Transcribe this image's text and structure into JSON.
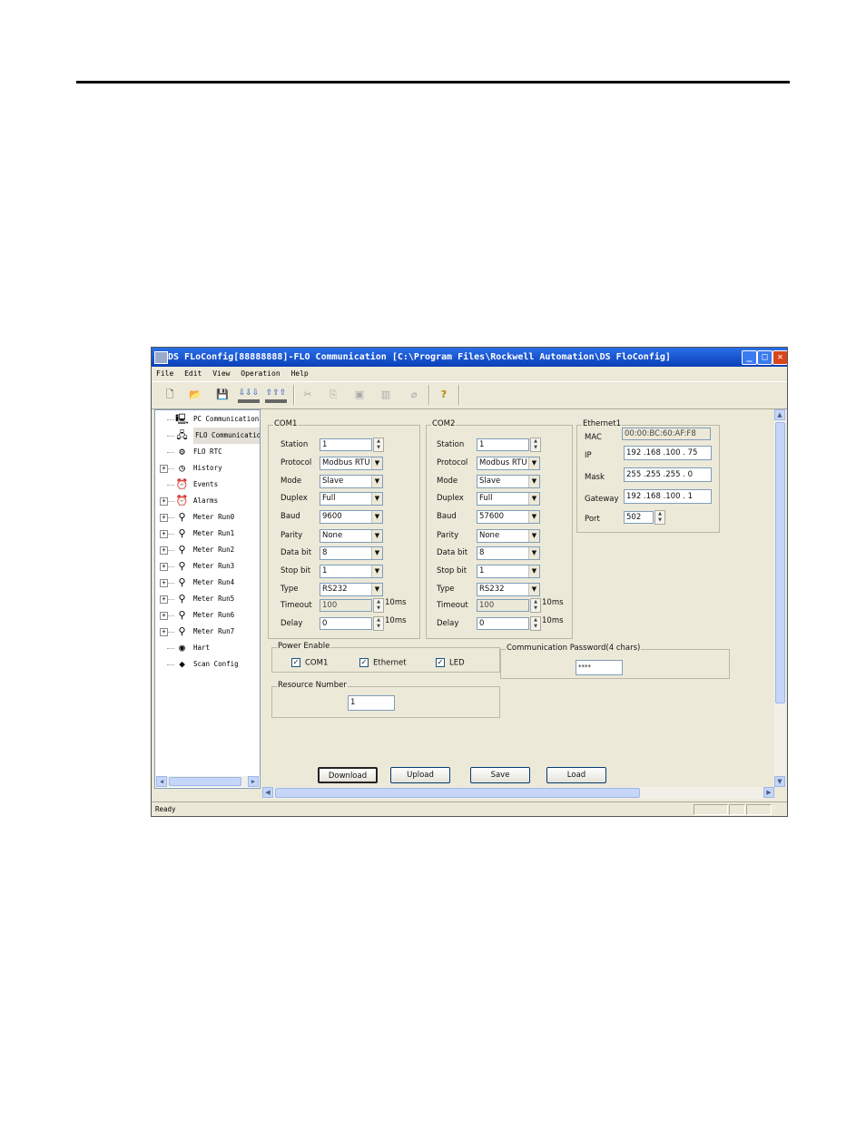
{
  "window": {
    "title": "DS FLoConfig[88888888]-FLO Communication [C:\\Program Files\\Rockwell Automation\\DS FloConfig]",
    "minimize": "_",
    "maximize": "□",
    "close": "✕"
  },
  "menu": [
    "File",
    "Edit",
    "View",
    "Operation",
    "Help"
  ],
  "toolbar": {
    "new": "🗋",
    "open": "📂",
    "save": "💾",
    "download": "⇩⇩⇩",
    "upload": "⇧⇧⇧",
    "cut": "✂",
    "copy": "⎘",
    "paste": "▣",
    "paste2": "▥",
    "erase": "⌀",
    "help": "?"
  },
  "tree": [
    {
      "label": "PC Communication",
      "icon": "computer-icon",
      "glyph": "🖳",
      "expander": false
    },
    {
      "label": "FLO Communicatio",
      "icon": "network-icon",
      "glyph": "🖧",
      "expander": false,
      "selected": true
    },
    {
      "label": "FLO RTC",
      "icon": "gear-icon",
      "glyph": "⚙",
      "expander": false
    },
    {
      "label": "History",
      "icon": "history-icon",
      "glyph": "◷",
      "expander": true
    },
    {
      "label": "Events",
      "icon": "alarm-clock-icon",
      "glyph": "⏰",
      "expander": false
    },
    {
      "label": "Alarms",
      "icon": "alarm-clock-icon",
      "glyph": "⏰",
      "expander": true
    },
    {
      "label": "Meter Run0",
      "icon": "meter-icon",
      "glyph": "⚲",
      "expander": true
    },
    {
      "label": "Meter Run1",
      "icon": "meter-icon",
      "glyph": "⚲",
      "expander": true
    },
    {
      "label": "Meter Run2",
      "icon": "meter-icon",
      "glyph": "⚲",
      "expander": true
    },
    {
      "label": "Meter Run3",
      "icon": "meter-icon",
      "glyph": "⚲",
      "expander": true
    },
    {
      "label": "Meter Run4",
      "icon": "meter-icon",
      "glyph": "⚲",
      "expander": true
    },
    {
      "label": "Meter Run5",
      "icon": "meter-icon",
      "glyph": "⚲",
      "expander": true
    },
    {
      "label": "Meter Run6",
      "icon": "meter-icon",
      "glyph": "⚲",
      "expander": true
    },
    {
      "label": "Meter Run7",
      "icon": "meter-icon",
      "glyph": "⚲",
      "expander": true
    },
    {
      "label": "Hart",
      "icon": "hart-icon",
      "glyph": "◉",
      "expander": false
    },
    {
      "label": "Scan Config",
      "icon": "scan-icon",
      "glyph": "◆",
      "expander": false
    }
  ],
  "com1": {
    "legend": "COM1",
    "station_label": "Station",
    "station": "1",
    "protocol_label": "Protocol",
    "protocol": "Modbus RTU",
    "mode_label": "Mode",
    "mode": "Slave",
    "duplex_label": "Duplex",
    "duplex": "Full",
    "baud_label": "Baud",
    "baud": "9600",
    "parity_label": "Parity",
    "parity": "None",
    "databit_label": "Data bit",
    "databit": "8",
    "stopbit_label": "Stop bit",
    "stopbit": "1",
    "type_label": "Type",
    "type": "RS232",
    "timeout_label": "Timeout",
    "timeout": "100",
    "timeout_unit": "10ms",
    "delay_label": "Delay",
    "delay": "0",
    "delay_unit": "10ms"
  },
  "com2": {
    "legend": "COM2",
    "station_label": "Station",
    "station": "1",
    "protocol_label": "Protocol",
    "protocol": "Modbus RTU",
    "mode_label": "Mode",
    "mode": "Slave",
    "duplex_label": "Duplex",
    "duplex": "Full",
    "baud_label": "Baud",
    "baud": "57600",
    "parity_label": "Parity",
    "parity": "None",
    "databit_label": "Data bit",
    "databit": "8",
    "stopbit_label": "Stop bit",
    "stopbit": "1",
    "type_label": "Type",
    "type": "RS232",
    "timeout_label": "Timeout",
    "timeout": "100",
    "timeout_unit": "10ms",
    "delay_label": "Delay",
    "delay": "0",
    "delay_unit": "10ms"
  },
  "ethernet": {
    "legend": "Ethernet1",
    "mac_label": "MAC",
    "mac": "00:00:BC:60:AF:F8",
    "ip_label": "IP",
    "ip": "192 .168 .100 . 75",
    "mask_label": "Mask",
    "mask": "255 .255 .255 .  0",
    "gateway_label": "Gateway",
    "gateway": "192 .168 .100 .  1",
    "port_label": "Port",
    "port": "502"
  },
  "power": {
    "legend": "Power Enable",
    "com1": "COM1",
    "ethernet": "Ethernet",
    "led": "LED",
    "check": "✓"
  },
  "password": {
    "legend": "Communication Password(4 chars)",
    "value": "****"
  },
  "resource": {
    "legend": "Resource Number",
    "value": "1"
  },
  "buttons": {
    "download": "Download",
    "upload": "Upload",
    "save": "Save",
    "load": "Load"
  },
  "status": {
    "text": "Ready"
  },
  "arrows": {
    "up": "▲",
    "down": "▼",
    "left": "◀",
    "right": "▶",
    "drop": "▼"
  }
}
